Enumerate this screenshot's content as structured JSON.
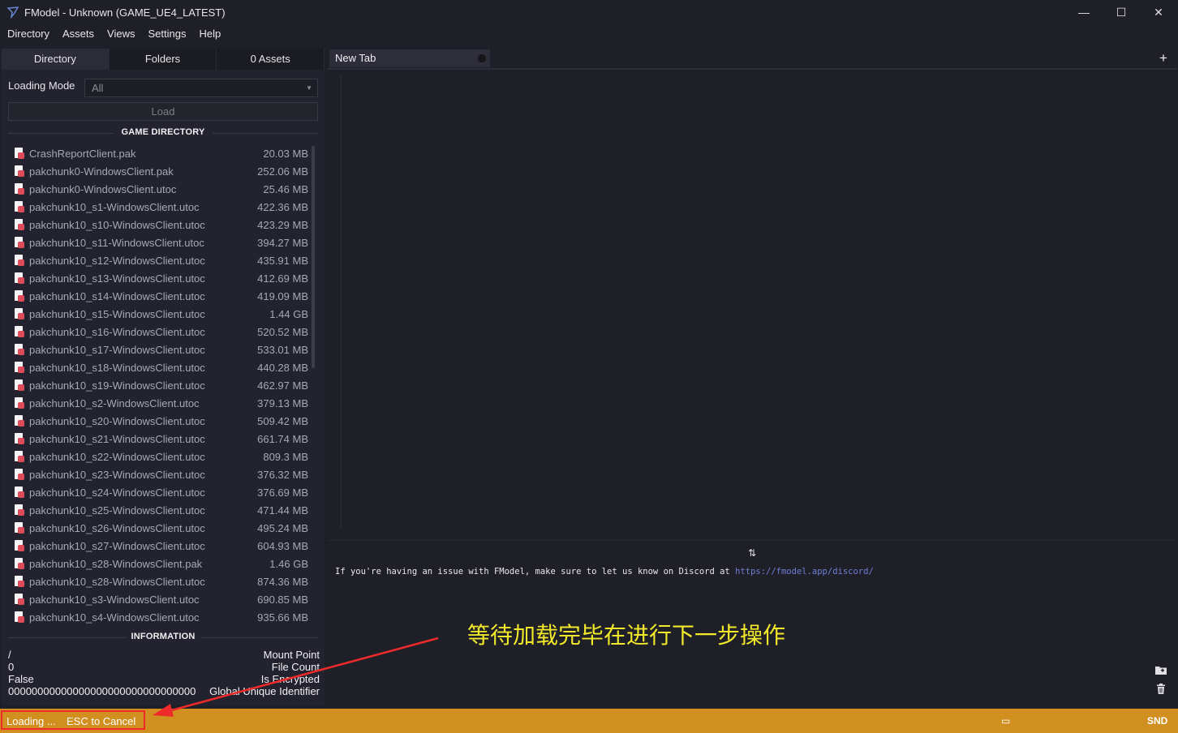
{
  "window": {
    "title": "FModel - Unknown (GAME_UE4_LATEST)",
    "minimize_glyph": "—",
    "maximize_glyph": "☐",
    "close_glyph": "✕"
  },
  "menu": [
    "Directory",
    "Assets",
    "Views",
    "Settings",
    "Help"
  ],
  "left_tabs": [
    {
      "label": "Directory",
      "active": true
    },
    {
      "label": "Folders",
      "active": false
    },
    {
      "label": "0 Assets",
      "active": false
    }
  ],
  "loading_mode": {
    "label": "Loading Mode",
    "value": "All",
    "arrow": "▼"
  },
  "load_button": "Load",
  "game_directory": {
    "header": "GAME DIRECTORY",
    "files": [
      {
        "name": "CrashReportClient.pak",
        "size": "20.03 MB"
      },
      {
        "name": "pakchunk0-WindowsClient.pak",
        "size": "252.06 MB"
      },
      {
        "name": "pakchunk0-WindowsClient.utoc",
        "size": "25.46 MB"
      },
      {
        "name": "pakchunk10_s1-WindowsClient.utoc",
        "size": "422.36 MB"
      },
      {
        "name": "pakchunk10_s10-WindowsClient.utoc",
        "size": "423.29 MB"
      },
      {
        "name": "pakchunk10_s11-WindowsClient.utoc",
        "size": "394.27 MB"
      },
      {
        "name": "pakchunk10_s12-WindowsClient.utoc",
        "size": "435.91 MB"
      },
      {
        "name": "pakchunk10_s13-WindowsClient.utoc",
        "size": "412.69 MB"
      },
      {
        "name": "pakchunk10_s14-WindowsClient.utoc",
        "size": "419.09 MB"
      },
      {
        "name": "pakchunk10_s15-WindowsClient.utoc",
        "size": "1.44 GB"
      },
      {
        "name": "pakchunk10_s16-WindowsClient.utoc",
        "size": "520.52 MB"
      },
      {
        "name": "pakchunk10_s17-WindowsClient.utoc",
        "size": "533.01 MB"
      },
      {
        "name": "pakchunk10_s18-WindowsClient.utoc",
        "size": "440.28 MB"
      },
      {
        "name": "pakchunk10_s19-WindowsClient.utoc",
        "size": "462.97 MB"
      },
      {
        "name": "pakchunk10_s2-WindowsClient.utoc",
        "size": "379.13 MB"
      },
      {
        "name": "pakchunk10_s20-WindowsClient.utoc",
        "size": "509.42 MB"
      },
      {
        "name": "pakchunk10_s21-WindowsClient.utoc",
        "size": "661.74 MB"
      },
      {
        "name": "pakchunk10_s22-WindowsClient.utoc",
        "size": "809.3 MB"
      },
      {
        "name": "pakchunk10_s23-WindowsClient.utoc",
        "size": "376.32 MB"
      },
      {
        "name": "pakchunk10_s24-WindowsClient.utoc",
        "size": "376.69 MB"
      },
      {
        "name": "pakchunk10_s25-WindowsClient.utoc",
        "size": "471.44 MB"
      },
      {
        "name": "pakchunk10_s26-WindowsClient.utoc",
        "size": "495.24 MB"
      },
      {
        "name": "pakchunk10_s27-WindowsClient.utoc",
        "size": "604.93 MB"
      },
      {
        "name": "pakchunk10_s28-WindowsClient.pak",
        "size": "1.46 GB"
      },
      {
        "name": "pakchunk10_s28-WindowsClient.utoc",
        "size": "874.36 MB"
      },
      {
        "name": "pakchunk10_s3-WindowsClient.utoc",
        "size": "690.85 MB"
      },
      {
        "name": "pakchunk10_s4-WindowsClient.utoc",
        "size": "935.66 MB"
      }
    ]
  },
  "information": {
    "header": "INFORMATION",
    "rows": [
      {
        "value": "/",
        "label": "Mount Point"
      },
      {
        "value": "0",
        "label": "File Count"
      },
      {
        "value": "False",
        "label": "Is Encrypted"
      },
      {
        "value": "00000000000000000000000000000000",
        "label": "Global Unique Identifier"
      }
    ]
  },
  "editor": {
    "tab_label": "New Tab",
    "add_tab_glyph": "+"
  },
  "splitter_glyph": "⇅",
  "console": {
    "message": "If you're having an issue with FModel, make sure to let us know on Discord at ",
    "link": "https://fmodel.app/discord/"
  },
  "side_icons": {
    "folder": "folder-icon",
    "trash": "trash-icon"
  },
  "annotation": {
    "caption": "等待加载完毕在进行下一步操作"
  },
  "status": {
    "loading": "Loading ...",
    "esc": "ESC to Cancel",
    "window_glyph": "▭",
    "snd": "SND"
  },
  "colors": {
    "background": "#1f1f27",
    "status_bar": "#d18f20",
    "annotation_red": "#ee2a2a",
    "annotation_yellow": "#f2e92a",
    "link": "#6f7fd8"
  }
}
